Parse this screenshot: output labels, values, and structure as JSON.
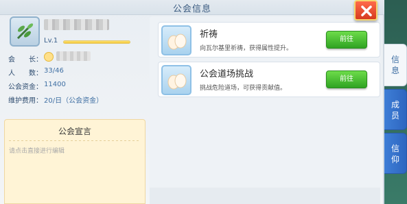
{
  "window": {
    "title": "公会信息"
  },
  "guild": {
    "level": "Lv.1",
    "exp_fraction": 1.0,
    "leader_label": "会　　长：",
    "members_label": "人　　数：",
    "members_value": "33/46",
    "funds_label": "公会资金：",
    "funds_value": "11400",
    "upkeep_label": "维护费用：",
    "upkeep_value": "20/日（公会资金）"
  },
  "declaration": {
    "title": "公会宣言",
    "hint": "请点击直接进行编辑"
  },
  "activities": [
    {
      "name": "祈祷",
      "desc": "向瓦尔基里祈祷，获得属性提升。",
      "button": "前往"
    },
    {
      "name": "公会道场挑战",
      "desc": "挑战危险道场，可获得贡献值。",
      "button": "前往"
    }
  ],
  "tabs": [
    {
      "label_top": "信",
      "label_bottom": "息",
      "active": true
    },
    {
      "label_top": "成",
      "label_bottom": "员",
      "active": false
    },
    {
      "label_top": "信",
      "label_bottom": "仰",
      "active": false
    }
  ],
  "colors": {
    "accent": "#3f6fa3",
    "go_button": "#3fb82e",
    "close": "#e24b2c"
  }
}
